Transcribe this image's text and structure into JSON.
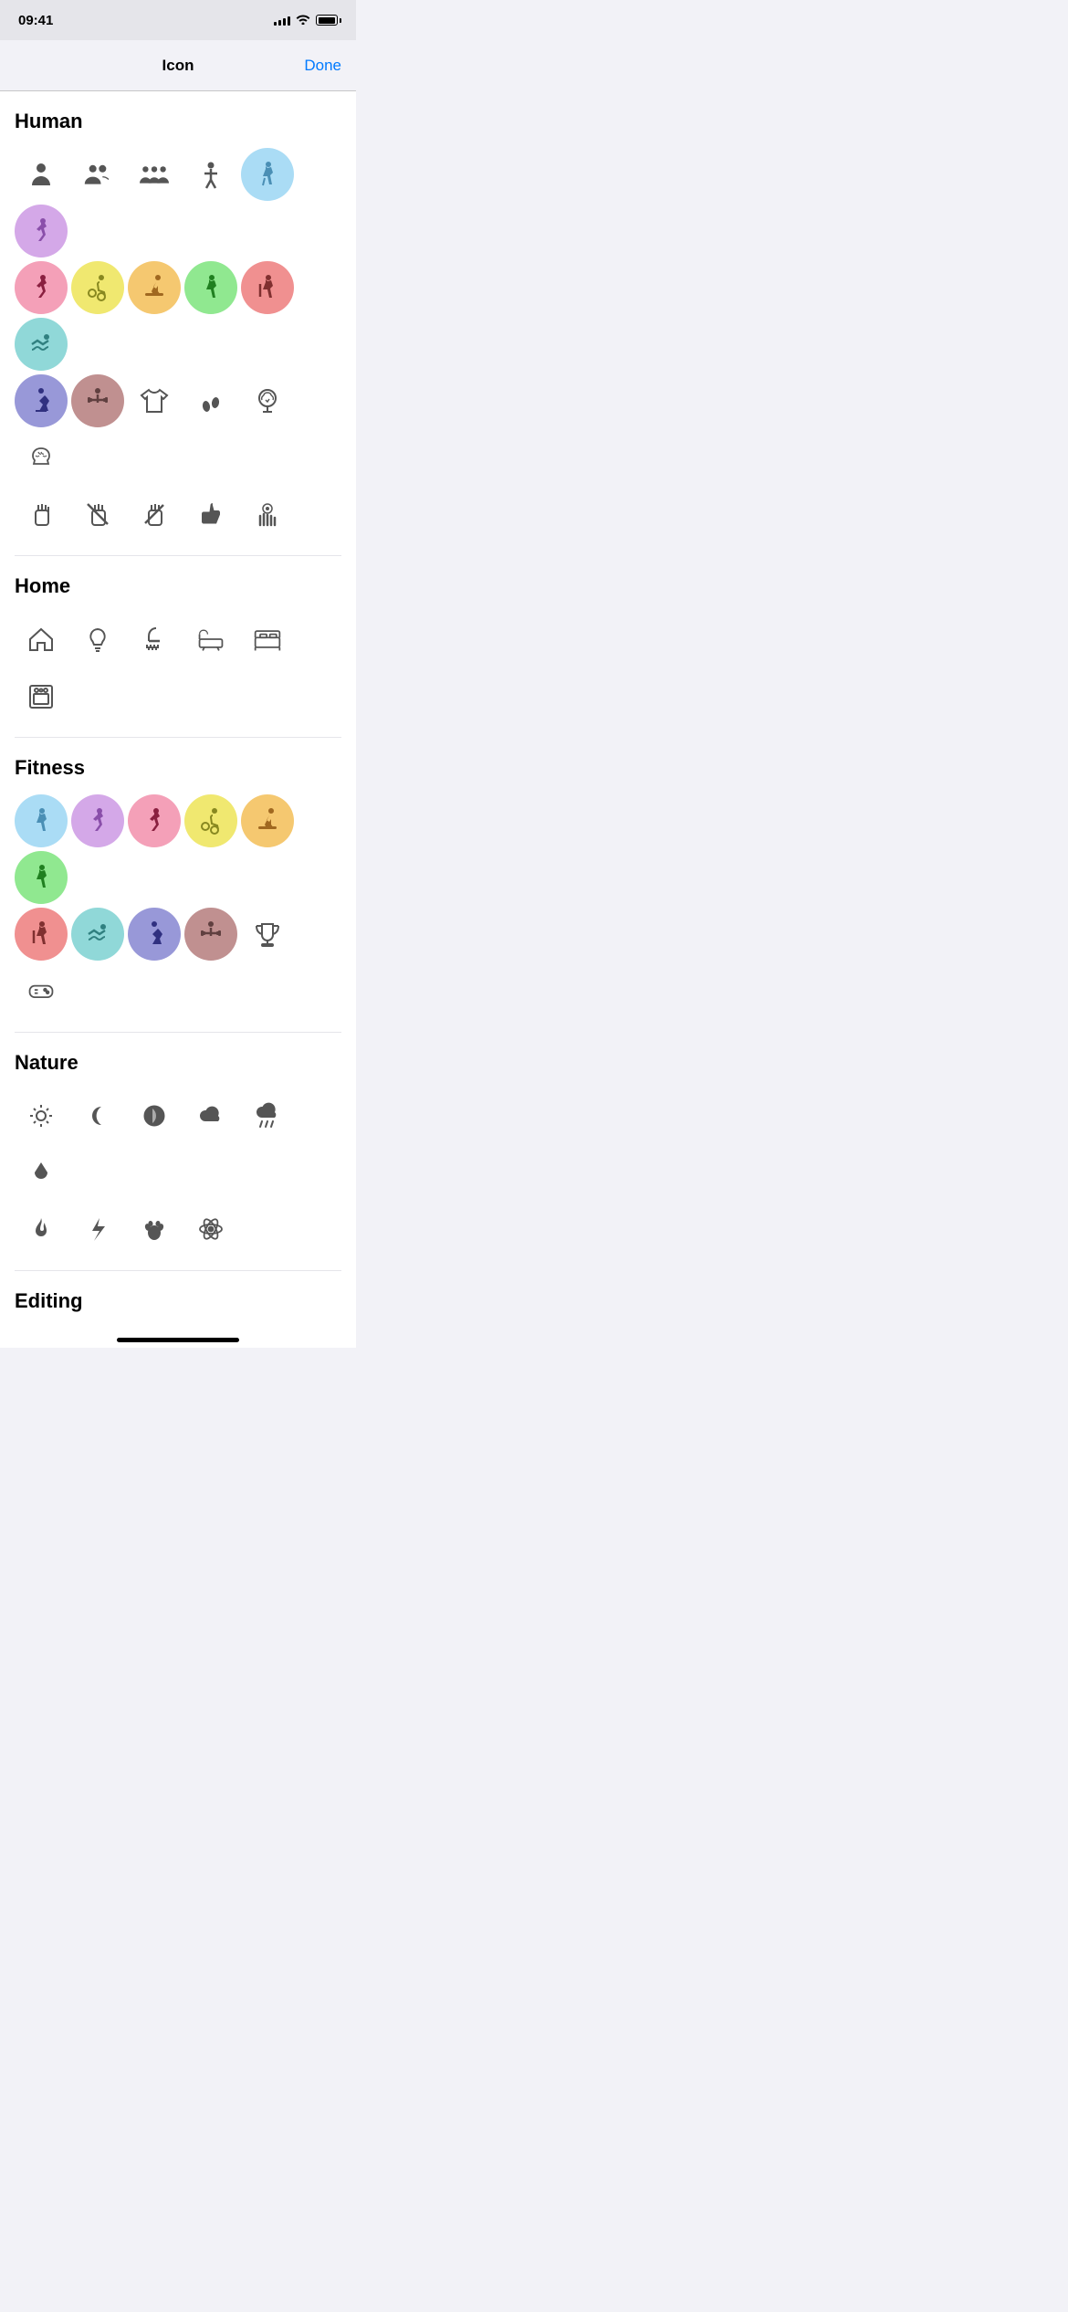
{
  "statusBar": {
    "time": "09:41",
    "battery": "100"
  },
  "header": {
    "title": "Icon",
    "doneLabel": "Done"
  },
  "sections": [
    {
      "id": "human",
      "title": "Human",
      "rows": [
        [
          {
            "icon": "person",
            "bg": "none",
            "color": "#555"
          },
          {
            "icon": "person2",
            "bg": "none",
            "color": "#555"
          },
          {
            "icon": "person3",
            "bg": "none",
            "color": "#555"
          },
          {
            "icon": "figure",
            "bg": "none",
            "color": "#555"
          },
          {
            "icon": "walk",
            "bg": "#aadcf5",
            "color": "#4a8fb5"
          },
          {
            "icon": "run",
            "bg": "#d4a8e8",
            "color": "#8a4faa"
          }
        ],
        [
          {
            "icon": "run2",
            "bg": "#f4a0b8",
            "color": "#8a2040"
          },
          {
            "icon": "wheelchair",
            "bg": "#f0e870",
            "color": "#888820"
          },
          {
            "icon": "treadmill",
            "bg": "#f5c870",
            "color": "#a06820"
          },
          {
            "icon": "walk2",
            "bg": "#90e890",
            "color": "#208020"
          },
          {
            "icon": "hike",
            "bg": "#f09090",
            "color": "#803030"
          },
          {
            "icon": "swim",
            "bg": "#90d8d8",
            "color": "#308080"
          }
        ],
        [
          {
            "icon": "skate",
            "bg": "#9898d8",
            "color": "#303080"
          },
          {
            "icon": "lift",
            "bg": "#c09090",
            "color": "#604040"
          },
          {
            "icon": "tshirt",
            "bg": "none",
            "color": "#555"
          },
          {
            "icon": "footprint",
            "bg": "none",
            "color": "#555"
          },
          {
            "icon": "brain-head",
            "bg": "none",
            "color": "#555"
          },
          {
            "icon": "brain",
            "bg": "none",
            "color": "#555"
          }
        ],
        [
          {
            "icon": "hand-stop",
            "bg": "none",
            "color": "#555"
          },
          {
            "icon": "hand-no",
            "bg": "none",
            "color": "#555"
          },
          {
            "icon": "hand-no2",
            "bg": "none",
            "color": "#555"
          },
          {
            "icon": "thumbsup",
            "bg": "none",
            "color": "#555"
          },
          {
            "icon": "touch",
            "bg": "none",
            "color": "#555"
          }
        ]
      ]
    },
    {
      "id": "home",
      "title": "Home",
      "rows": [
        [
          {
            "icon": "house",
            "bg": "none",
            "color": "#555"
          },
          {
            "icon": "lightbulb",
            "bg": "none",
            "color": "#555"
          },
          {
            "icon": "shower",
            "bg": "none",
            "color": "#555"
          },
          {
            "icon": "bathtub",
            "bg": "none",
            "color": "#555"
          },
          {
            "icon": "bed",
            "bg": "none",
            "color": "#555"
          },
          {
            "icon": "oven",
            "bg": "none",
            "color": "#555"
          }
        ]
      ]
    },
    {
      "id": "fitness",
      "title": "Fitness",
      "rows": [
        [
          {
            "icon": "walk",
            "bg": "#aadcf5",
            "color": "#4a8fb5"
          },
          {
            "icon": "run2",
            "bg": "#d4a8e8",
            "color": "#8a4faa"
          },
          {
            "icon": "run3",
            "bg": "#f4a0b8",
            "color": "#8a2040"
          },
          {
            "icon": "wheelchair",
            "bg": "#f0e870",
            "color": "#888820"
          },
          {
            "icon": "treadmill",
            "bg": "#f5c870",
            "color": "#a06820"
          },
          {
            "icon": "walk2",
            "bg": "#90e890",
            "color": "#208020"
          }
        ],
        [
          {
            "icon": "hike",
            "bg": "#f09090",
            "color": "#803030"
          },
          {
            "icon": "swim",
            "bg": "#90d8d8",
            "color": "#308080"
          },
          {
            "icon": "skate",
            "bg": "#9898d8",
            "color": "#303080"
          },
          {
            "icon": "lift",
            "bg": "#c09090",
            "color": "#604040"
          },
          {
            "icon": "trophy",
            "bg": "none",
            "color": "#555"
          },
          {
            "icon": "gamepad",
            "bg": "none",
            "color": "#555"
          }
        ]
      ]
    },
    {
      "id": "nature",
      "title": "Nature",
      "rows": [
        [
          {
            "icon": "sun",
            "bg": "none",
            "color": "#555"
          },
          {
            "icon": "moon",
            "bg": "none",
            "color": "#555"
          },
          {
            "icon": "moon-full",
            "bg": "none",
            "color": "#555"
          },
          {
            "icon": "cloud",
            "bg": "none",
            "color": "#555"
          },
          {
            "icon": "cloud-rain",
            "bg": "none",
            "color": "#555"
          },
          {
            "icon": "drop",
            "bg": "none",
            "color": "#555"
          }
        ],
        [
          {
            "icon": "fire",
            "bg": "none",
            "color": "#555"
          },
          {
            "icon": "lightning",
            "bg": "none",
            "color": "#555"
          },
          {
            "icon": "paw",
            "bg": "none",
            "color": "#555"
          },
          {
            "icon": "atom",
            "bg": "none",
            "color": "#555"
          }
        ]
      ]
    }
  ],
  "editingLabel": "Editing"
}
